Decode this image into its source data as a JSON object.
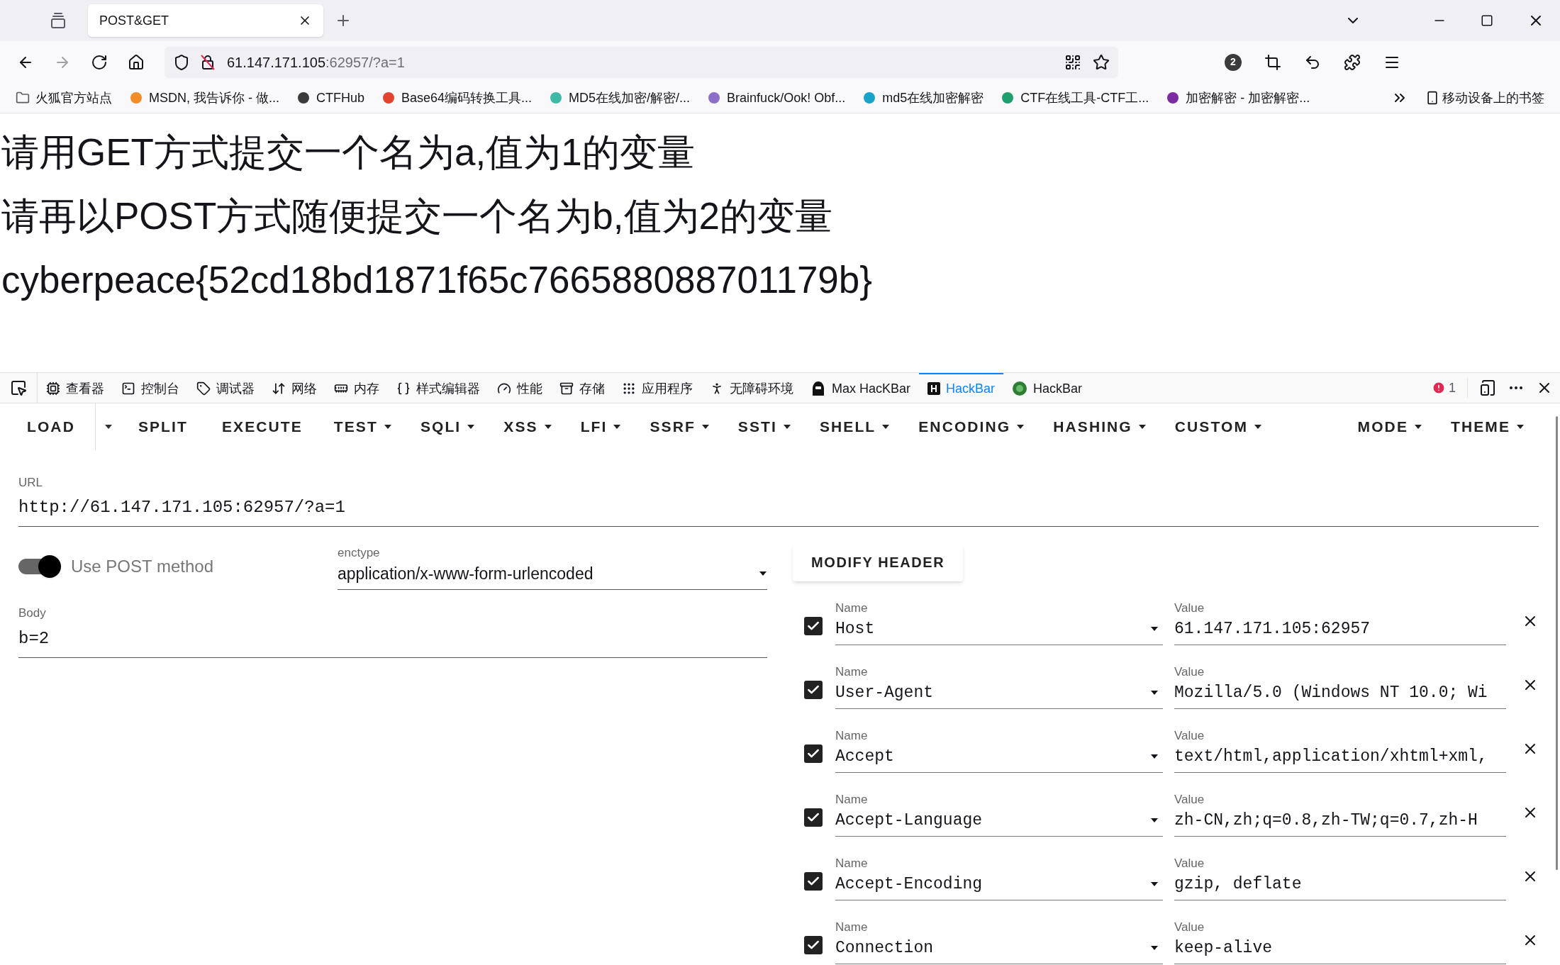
{
  "browser": {
    "tabs": [
      {
        "title": "POST&GET",
        "selected": true
      }
    ],
    "address": {
      "host": "61.147.171.105",
      "rest": ":62957/?a=1"
    },
    "extension_badge": "2",
    "bookmarks": [
      {
        "label": "火狐官方站点",
        "kind": "folder"
      },
      {
        "label": "MSDN, 我告诉你 - 做...",
        "color": "#f28c28"
      },
      {
        "label": "CTFHub",
        "color": "#3b3b3b"
      },
      {
        "label": "Base64编码转换工具...",
        "color": "#e0442f"
      },
      {
        "label": "MD5在线加密/解密/...",
        "color": "#3fb8a8"
      },
      {
        "label": "Brainfuck/Ook! Obf...",
        "color": "#8c6fc8"
      },
      {
        "label": "md5在线加密解密",
        "color": "#1aa3c9"
      },
      {
        "label": "CTF在线工具-CTF工...",
        "color": "#1f9e6e"
      },
      {
        "label": "加密解密 - 加密解密...",
        "color": "#7a2ca0"
      }
    ],
    "mobile_bookmarks": "移动设备上的书签"
  },
  "page": {
    "lines": [
      "请用GET方式提交一个名为a,值为1的变量",
      "请再以POST方式随便提交一个名为b,值为2的变量",
      "cyberpeace{52cd18bd1871f65c766588088701179b}"
    ]
  },
  "devtools": {
    "tabs": [
      {
        "label": "查看器",
        "selected": false
      },
      {
        "label": "控制台",
        "selected": false
      },
      {
        "label": "调试器",
        "selected": false
      },
      {
        "label": "网络",
        "selected": false
      },
      {
        "label": "内存",
        "selected": false
      },
      {
        "label": "样式编辑器",
        "selected": false
      },
      {
        "label": "性能",
        "selected": false
      },
      {
        "label": "存储",
        "selected": false
      },
      {
        "label": "应用程序",
        "selected": false
      },
      {
        "label": "无障碍环境",
        "selected": false
      },
      {
        "label": "Max HacKBar",
        "selected": false
      },
      {
        "label": "HackBar",
        "selected": true
      },
      {
        "label": "HackBar",
        "selected": false
      }
    ],
    "error_count": "1"
  },
  "hackbar": {
    "menu": [
      {
        "label": "LOAD",
        "kind": "split"
      },
      {
        "label": "SPLIT",
        "kind": "button"
      },
      {
        "label": "EXECUTE",
        "kind": "button"
      },
      {
        "label": "TEST",
        "kind": "dropdown"
      },
      {
        "label": "SQLI",
        "kind": "dropdown"
      },
      {
        "label": "XSS",
        "kind": "dropdown"
      },
      {
        "label": "LFI",
        "kind": "dropdown"
      },
      {
        "label": "SSRF",
        "kind": "dropdown"
      },
      {
        "label": "SSTI",
        "kind": "dropdown"
      },
      {
        "label": "SHELL",
        "kind": "dropdown"
      },
      {
        "label": "ENCODING",
        "kind": "dropdown"
      },
      {
        "label": "HASHING",
        "kind": "dropdown"
      },
      {
        "label": "CUSTOM",
        "kind": "dropdown"
      }
    ],
    "menu_right": [
      {
        "label": "MODE",
        "kind": "dropdown"
      },
      {
        "label": "THEME",
        "kind": "dropdown"
      }
    ],
    "url": {
      "label": "URL",
      "value": "http://61.147.171.105:62957/?a=1"
    },
    "post_toggle": {
      "label": "Use POST method",
      "on": true
    },
    "enctype": {
      "label": "enctype",
      "value": "application/x-www-form-urlencoded"
    },
    "body": {
      "label": "Body",
      "value": "b=2"
    },
    "modify_header_button": "MODIFY HEADER",
    "headers": [
      {
        "name_label": "Name",
        "name": "Host",
        "value_label": "Value",
        "value": "61.147.171.105:62957",
        "checked": true
      },
      {
        "name_label": "Name",
        "name": "User-Agent",
        "value_label": "Value",
        "value": "Mozilla/5.0 (Windows NT 10.0; Wi",
        "checked": true
      },
      {
        "name_label": "Name",
        "name": "Accept",
        "value_label": "Value",
        "value": "text/html,application/xhtml+xml,",
        "checked": true
      },
      {
        "name_label": "Name",
        "name": "Accept-Language",
        "value_label": "Value",
        "value": "zh-CN,zh;q=0.8,zh-TW;q=0.7,zh-H",
        "checked": true
      },
      {
        "name_label": "Name",
        "name": "Accept-Encoding",
        "value_label": "Value",
        "value": "gzip, deflate",
        "checked": true
      },
      {
        "name_label": "Name",
        "name": "Connection",
        "value_label": "Value",
        "value": "keep-alive",
        "checked": true
      }
    ]
  }
}
